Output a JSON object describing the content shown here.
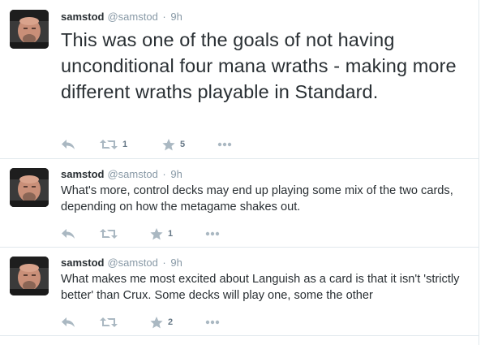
{
  "tweets": [
    {
      "name": "samstod",
      "handle": "@samstod",
      "separator": "·",
      "time": "9h",
      "text": "This was one of the goals of not having unconditional four mana wraths - making more different wraths playable in Standard.",
      "retweets": "1",
      "favorites": "5"
    },
    {
      "name": "samstod",
      "handle": "@samstod",
      "separator": "·",
      "time": "9h",
      "text": "What's more, control decks may end up playing some mix of the two cards, depending on how the metagame shakes out.",
      "retweets": "",
      "favorites": "1"
    },
    {
      "name": "samstod",
      "handle": "@samstod",
      "separator": "·",
      "time": "9h",
      "text": "What makes me most excited about Languish as a card is that it isn't 'strictly better' than Crux. Some decks will play one, some the other",
      "retweets": "",
      "favorites": "2"
    }
  ],
  "icons": {
    "reply": "reply-icon",
    "retweet": "retweet-icon",
    "favorite": "star-icon",
    "more": "more-dots-icon"
  },
  "colors": {
    "text": "#292f33",
    "muted": "#8899a6",
    "icon": "#aab8c2",
    "divider": "#e1e8ed"
  }
}
